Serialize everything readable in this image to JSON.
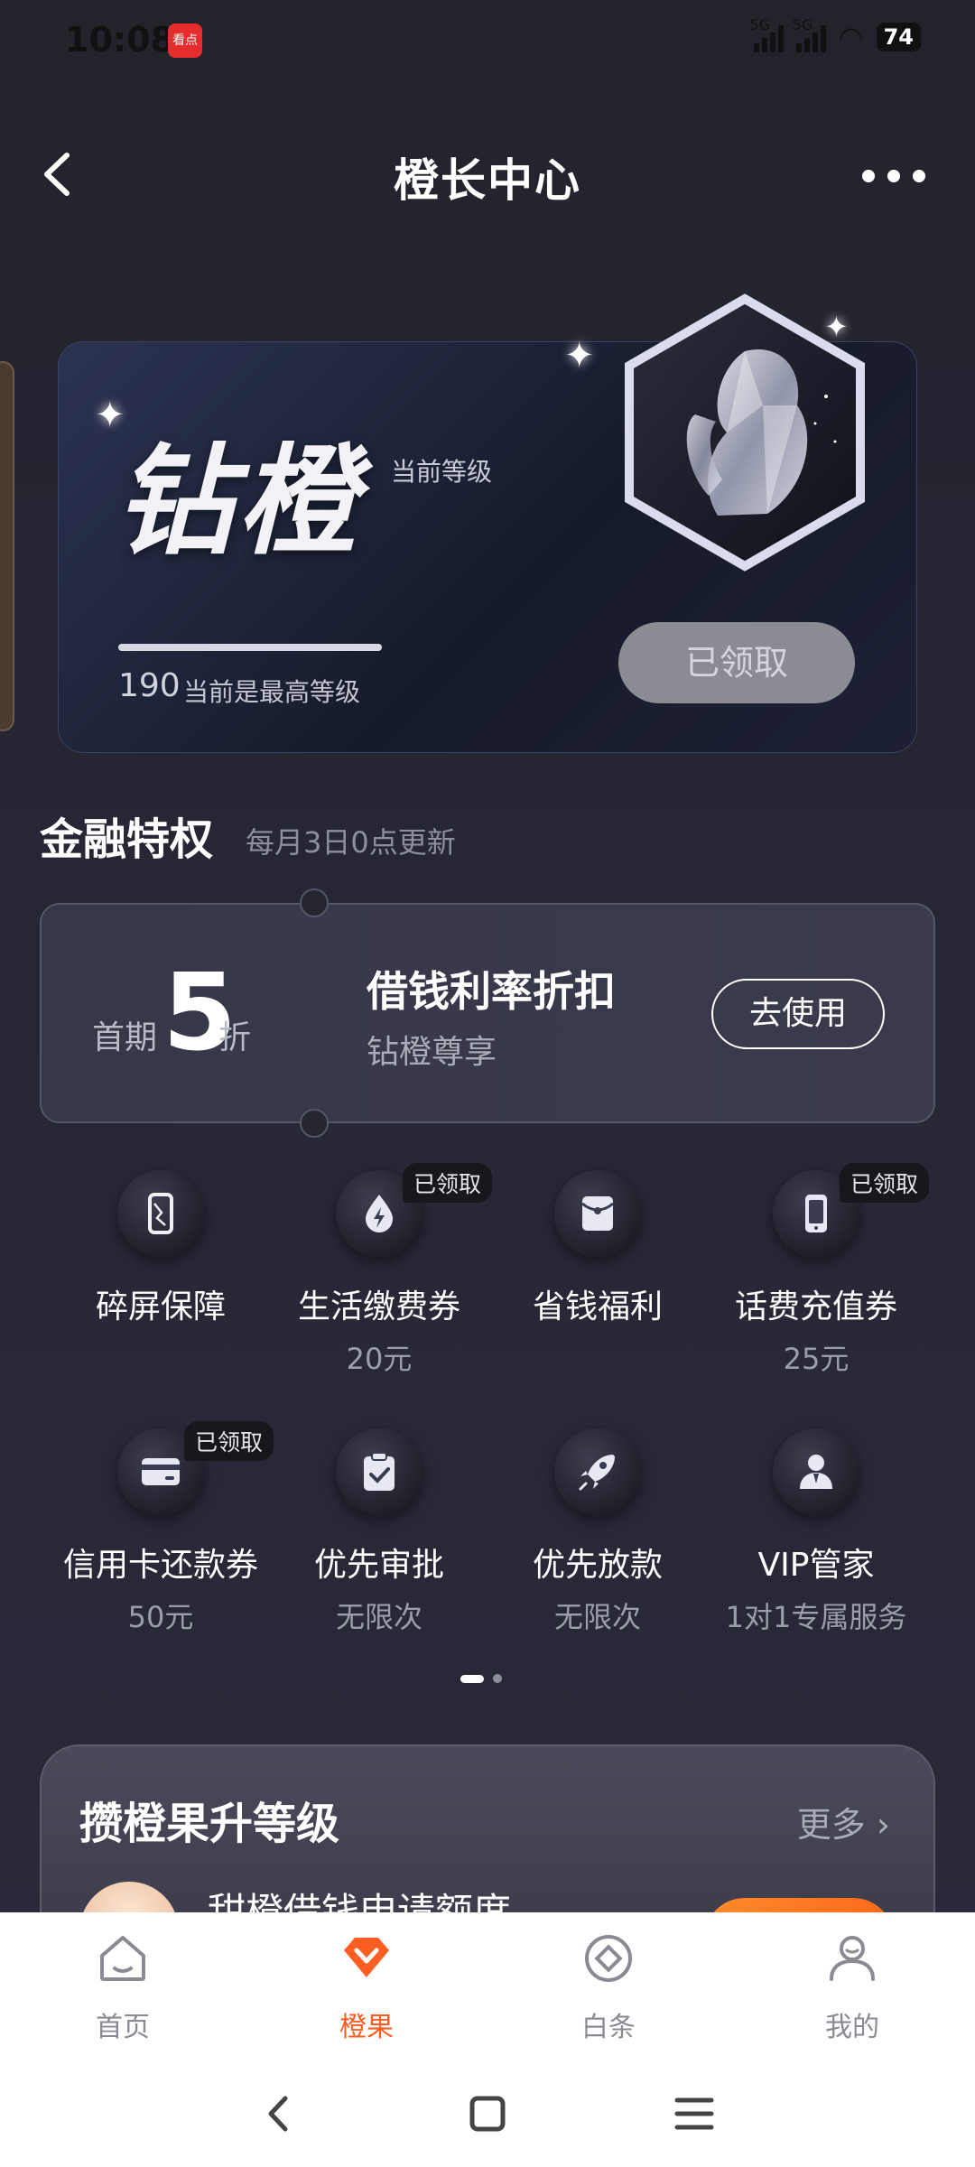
{
  "status": {
    "time": "10:08",
    "app_badge": "看点",
    "signal_1": "5G",
    "signal_2": "5G",
    "battery": "74"
  },
  "header": {
    "title": "橙长中心"
  },
  "level_card": {
    "level_name": "钻橙",
    "level_tag": "当前等级",
    "points": "190",
    "points_note": "当前是最高等级",
    "progress": 1.0,
    "claim_button": "已领取"
  },
  "finance": {
    "title": "金融特权",
    "subtitle": "每月3日0点更新",
    "coupon": {
      "prefix": "首期",
      "number": "5",
      "unit": "折",
      "title": "借钱利率折扣",
      "desc": "钻橙尊享",
      "button": "去使用"
    }
  },
  "perks": [
    {
      "name": "碎屏保障",
      "value": "",
      "badge": "",
      "icon": "cracked-phone-icon"
    },
    {
      "name": "生活缴费券",
      "value": "20元",
      "badge": "已领取",
      "icon": "bolt-drop-icon"
    },
    {
      "name": "省钱福利",
      "value": "",
      "badge": "",
      "icon": "red-envelope-icon"
    },
    {
      "name": "话费充值券",
      "value": "25元",
      "badge": "已领取",
      "icon": "phone-icon"
    },
    {
      "name": "信用卡还款券",
      "value": "50元",
      "badge": "已领取",
      "icon": "credit-card-icon"
    },
    {
      "name": "优先审批",
      "value": "无限次",
      "badge": "",
      "icon": "clipboard-check-icon"
    },
    {
      "name": "优先放款",
      "value": "无限次",
      "badge": "",
      "icon": "rocket-icon"
    },
    {
      "name": "VIP管家",
      "value": "1对1专属服务",
      "badge": "",
      "icon": "butler-icon"
    }
  ],
  "upgrade": {
    "title": "攒橙果升等级",
    "more": "更多 ›",
    "item": "甜橙借钱申请额度"
  },
  "tabs": [
    {
      "label": "首页",
      "icon": "home-icon"
    },
    {
      "label": "橙果",
      "icon": "orange-gem-icon",
      "active": true
    },
    {
      "label": "白条",
      "icon": "diamond-circle-icon"
    },
    {
      "label": "我的",
      "icon": "user-icon"
    }
  ],
  "colors": {
    "accent": "#ff5e22",
    "background": "#262634",
    "card": "#363748"
  }
}
